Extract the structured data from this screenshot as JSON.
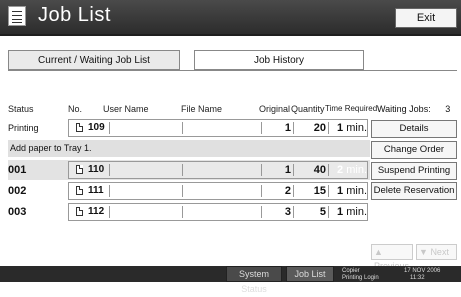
{
  "window": {
    "title": "Job List",
    "exit_label": "Exit"
  },
  "tabs": [
    {
      "label": "Current / Waiting Job List",
      "active": true
    },
    {
      "label": "Job History",
      "active": false
    }
  ],
  "columns": {
    "status": "Status",
    "no": "No.",
    "user_name": "User Name",
    "file_name": "File Name",
    "original": "Original",
    "quantity": "Quantity",
    "time_required": "Time Required"
  },
  "waiting": {
    "label": "Waiting Jobs:",
    "count": "3"
  },
  "jobs": [
    {
      "status": "Printing",
      "no": "109",
      "original": "1",
      "quantity": "20",
      "time": "1",
      "unit": "min."
    },
    {
      "status": "001",
      "no": "110",
      "original": "1",
      "quantity": "40",
      "time": "2",
      "unit": "min."
    },
    {
      "status": "002",
      "no": "111",
      "original": "2",
      "quantity": "15",
      "time": "1",
      "unit": "min."
    },
    {
      "status": "003",
      "no": "112",
      "original": "3",
      "quantity": "5",
      "time": "1",
      "unit": "min."
    }
  ],
  "notice": "Add paper to Tray 1.",
  "side_buttons": {
    "details": "Details",
    "change_order": "Change Order",
    "suspend": "Suspend Printing",
    "delete": "Delete Reservation"
  },
  "paging": {
    "previous": "Previous",
    "next": "Next"
  },
  "bottom": {
    "system_status": "System Status",
    "job_list": "Job List",
    "mode_line1": "Copier",
    "mode_line2": "Printing Login",
    "date": "17 NOV 2006",
    "time": "11:32"
  },
  "colors": {
    "titlebar": "#2c2c2c",
    "selected_row": "#e3e3e3"
  },
  "icons": [
    "job-list-icon",
    "document-icon",
    "previous-arrow-icon",
    "next-arrow-icon"
  ]
}
